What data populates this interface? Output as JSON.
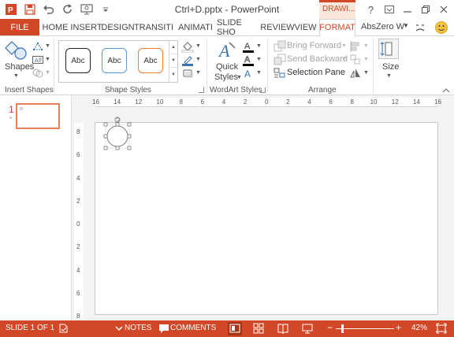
{
  "window": {
    "title": "Ctrl+D.pptx - PowerPoint",
    "context_tab": "DRAWI..."
  },
  "quick_access": {
    "icons": [
      "powerpoint-logo-icon",
      "save-icon",
      "undo-icon",
      "redo-icon",
      "presenter-icon",
      "customize-icon"
    ]
  },
  "window_controls": {
    "help": "?",
    "icons": [
      "help-icon",
      "ribbon-display-icon",
      "minimize-icon",
      "restore-icon",
      "close-icon"
    ]
  },
  "tabs": {
    "file": "FILE",
    "items": [
      "HOME",
      "INSERT",
      "DESIGN",
      "TRANSITI",
      "ANIMATI",
      "SLIDE SHO",
      "REVIEW",
      "VIEW",
      "FORMAT"
    ],
    "active": "FORMAT",
    "user": "AbsZero W"
  },
  "ribbon": {
    "insert_shapes": {
      "label": "Insert Shapes",
      "shapes_button": "Shapes"
    },
    "shape_styles": {
      "label": "Shape Styles",
      "gallery": [
        {
          "text": "Abc",
          "border": "#222222"
        },
        {
          "text": "Abc",
          "border": "#5b9bd5"
        },
        {
          "text": "Abc",
          "border": "#ed7d31"
        }
      ]
    },
    "wordart": {
      "label": "WordArt Styles",
      "quick_styles_line1": "Quick",
      "quick_styles_line2": "Styles"
    },
    "arrange": {
      "label": "Arrange",
      "bring_forward": "Bring Forward",
      "send_backward": "Send Backward",
      "selection_pane": "Selection Pane"
    },
    "size": {
      "label": "",
      "button": "Size"
    }
  },
  "slides": {
    "current_number": "1",
    "asterisk": "*"
  },
  "rulers": {
    "horizontal": [
      "16",
      "14",
      "12",
      "10",
      "8",
      "6",
      "4",
      "2",
      "0",
      "2",
      "4",
      "6",
      "8",
      "10",
      "12",
      "14",
      "16"
    ],
    "vertical": [
      "8",
      "6",
      "4",
      "2",
      "0",
      "2",
      "4",
      "6",
      "8"
    ]
  },
  "statusbar": {
    "slide_info": "SLIDE 1 OF 1",
    "notes": "NOTES",
    "comments": "COMMENTS",
    "zoom_minus": "−",
    "zoom_plus": "+",
    "zoom": "42%"
  },
  "colors": {
    "accent": "#d24726",
    "selection": "#e8805d"
  }
}
